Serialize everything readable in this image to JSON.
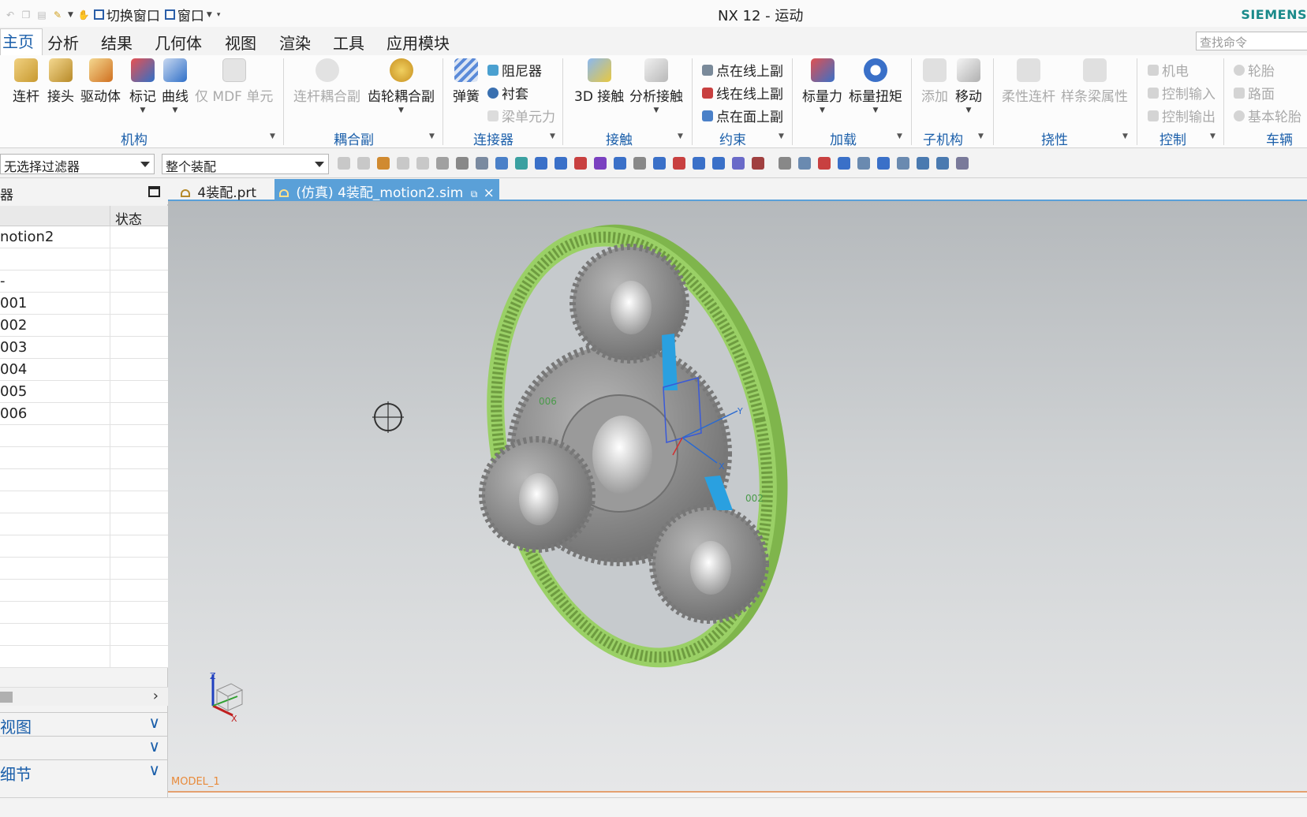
{
  "window": {
    "title": "NX 12 - 运动",
    "brand": "SIEMENS"
  },
  "quick_access": {
    "switch_window": "切换窗口",
    "window": "窗口"
  },
  "menu": {
    "tabs": [
      "主页",
      "分析",
      "结果",
      "几何体",
      "视图",
      "渲染",
      "工具",
      "应用模块"
    ],
    "active": "主页"
  },
  "search": {
    "placeholder": "查找命令"
  },
  "ribbon": {
    "mechanism": {
      "label": "机构",
      "buttons": [
        "连杆",
        "接头",
        "驱动体",
        "标记",
        "曲线",
        "仅 MDF 单元"
      ]
    },
    "coupler": {
      "label": "耦合副",
      "buttons": [
        "连杆耦合副",
        "齿轮耦合副"
      ]
    },
    "connector": {
      "label": "连接器",
      "spring": "弹簧",
      "damper": "阻尼器",
      "bushing": "衬套",
      "beam_force": "梁单元力"
    },
    "contact": {
      "label": "接触",
      "buttons": [
        "3D 接触",
        "分析接触"
      ]
    },
    "constraint": {
      "label": "约束",
      "items": [
        "点在线上副",
        "线在线上副",
        "点在面上副"
      ]
    },
    "load": {
      "label": "加载",
      "buttons": [
        "标量力",
        "标量扭矩"
      ]
    },
    "submechanism": {
      "label": "子机构",
      "buttons": [
        "添加",
        "移动"
      ]
    },
    "flexible": {
      "label": "挠性",
      "buttons": [
        "柔性连杆",
        "样条梁属性"
      ]
    },
    "control": {
      "label": "控制",
      "items": [
        "机电",
        "控制输入",
        "控制输出"
      ]
    },
    "vehicle": {
      "label": "车辆",
      "items": [
        "轮胎",
        "路面",
        "基本轮胎"
      ]
    }
  },
  "toolbar2": {
    "filter": "无选择过滤器",
    "assembly": "整个装配"
  },
  "navigator": {
    "title": "器",
    "column_status": "状态",
    "rows": [
      "notion2",
      "",
      "-",
      "001",
      "002",
      "003",
      "004",
      "005",
      "006",
      "",
      "",
      "",
      "",
      "",
      "",
      "",
      "",
      "",
      "",
      ""
    ],
    "panels": [
      "视图",
      "",
      "细节"
    ]
  },
  "doc_tabs": [
    {
      "label": "4装配.prt",
      "active": false
    },
    {
      "label": "(仿真) 4装配_motion2.sim",
      "active": true,
      "close": "×"
    }
  ],
  "viewport": {
    "model_name": "MODEL_1",
    "label_006": "006",
    "label_002": "002",
    "axis_z": "Z",
    "axis_x": "X",
    "axis_y": "Y"
  },
  "colors": {
    "accent": "#1b5faa",
    "ring_gear": "#8fc65a",
    "tab_active": "#5aa0d8",
    "gear": "#8c8c8c"
  }
}
